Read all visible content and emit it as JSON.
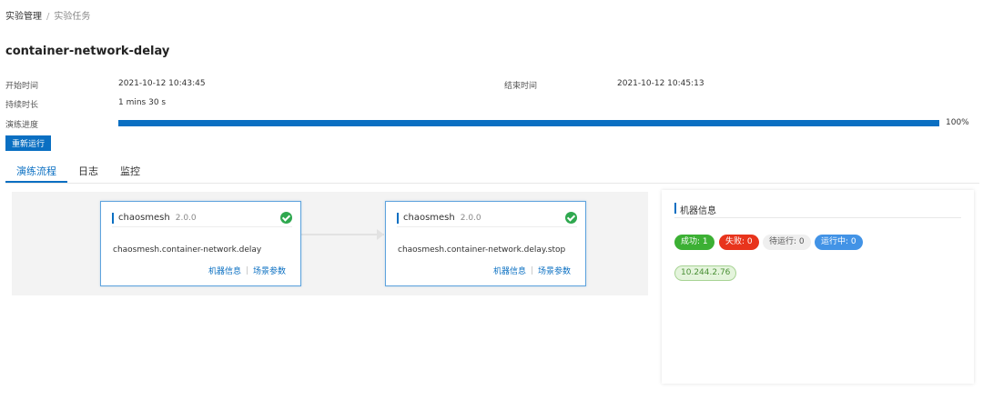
{
  "breadcrumb": {
    "root": "实验管理",
    "separator": "/",
    "current": "实验任务"
  },
  "experiment": {
    "title": "container-network-delay",
    "start_label": "开始时间",
    "start_value": "2021-10-12 10:43:45",
    "end_label": "结束时间",
    "end_value": "2021-10-12 10:45:13",
    "duration_label": "持续时长",
    "duration_value": "1 mins  30 s",
    "progress_label": "演练进度",
    "progress_percent": 100,
    "progress_text": "100%",
    "rerun_label": "重新运行"
  },
  "tabs": [
    {
      "label": "演练流程",
      "active": true
    },
    {
      "label": "日志",
      "active": false
    },
    {
      "label": "监控",
      "active": false
    }
  ],
  "flow": {
    "nodes": [
      {
        "name": "chaosmesh",
        "version": "2.0.0",
        "task": "chaosmesh.container-network.delay",
        "status": "success",
        "link_machine": "机器信息",
        "link_params": "场景参数"
      },
      {
        "name": "chaosmesh",
        "version": "2.0.0",
        "task": "chaosmesh.container-network.delay.stop",
        "status": "success",
        "link_machine": "机器信息",
        "link_params": "场景参数"
      }
    ]
  },
  "machine_panel": {
    "title": "机器信息",
    "stats": {
      "success": "成功: 1",
      "fail": "失败: 0",
      "waiting": "待运行: 0",
      "running": "运行中: 0"
    },
    "hosts": [
      "10.244.2.76"
    ]
  },
  "colors": {
    "primary": "#0a6fc2",
    "success": "#3cb034",
    "fail": "#e8341c",
    "running": "#4293e6",
    "check": "#2fa84f"
  }
}
